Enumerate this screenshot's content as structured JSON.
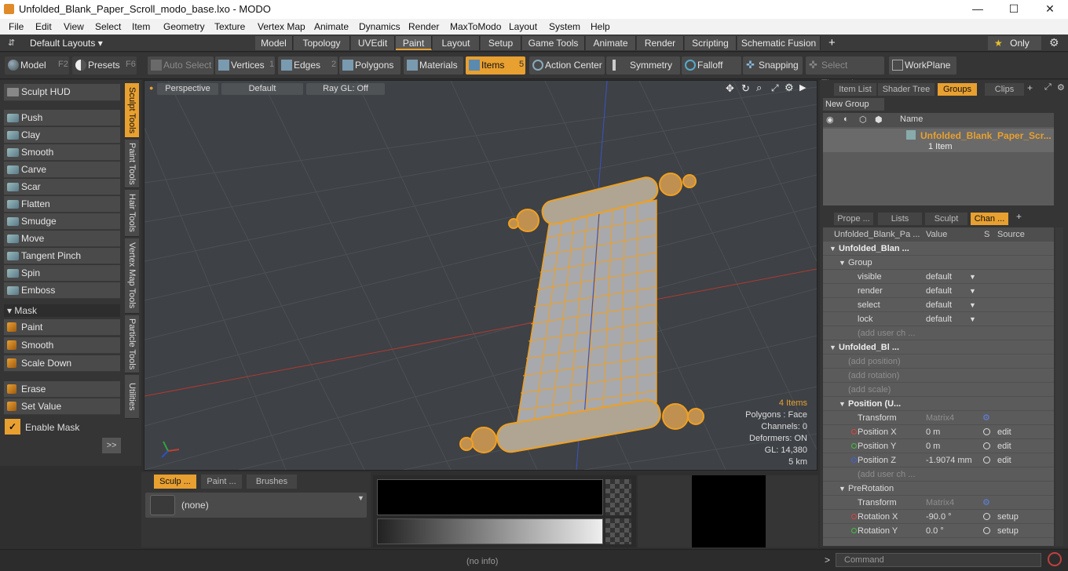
{
  "window": {
    "title": "Unfolded_Blank_Paper_Scroll_modo_base.lxo - MODO",
    "minimize": "—",
    "maximize": "☐",
    "close": "✕"
  },
  "menu": [
    "File",
    "Edit",
    "View",
    "Select",
    "Item",
    "Geometry",
    "Texture",
    "Vertex Map",
    "Animate",
    "Dynamics",
    "Render",
    "MaxToModo",
    "Layout",
    "System",
    "Help"
  ],
  "layoutbar": {
    "layouts": "Default Layouts ▾",
    "tabs": [
      "Model",
      "Topology",
      "UVEdit",
      "Paint",
      "Layout",
      "Setup",
      "Game Tools",
      "Animate",
      "Render",
      "Scripting",
      "Schematic Fusion"
    ],
    "active_tab": "Paint",
    "only": "Only",
    "plus": "+"
  },
  "toolbar": {
    "model": "Model",
    "model_key": "F2",
    "presets": "Presets",
    "presets_key": "F6",
    "auto_select": "Auto Select",
    "vertices": "Vertices",
    "vertices_key": "1",
    "edges": "Edges",
    "edges_key": "2",
    "polygons": "Polygons",
    "materials": "Materials",
    "items": "Items",
    "items_key": "5",
    "action_center": "Action Center",
    "symmetry": "Symmetry",
    "falloff": "Falloff",
    "snapping": "Snapping",
    "select_through": "Select Through",
    "workplane": "WorkPlane"
  },
  "left": {
    "sculpt_hud": "Sculpt HUD",
    "tools": [
      "Push",
      "Clay",
      "Smooth",
      "Carve",
      "Scar",
      "Flatten",
      "Smudge",
      "Move",
      "Tangent Pinch",
      "Spin",
      "Emboss"
    ],
    "mask_header": "Mask",
    "mask_tools": [
      "Paint",
      "Smooth",
      "Scale Down"
    ],
    "erase": "Erase",
    "set_value": "Set Value",
    "enable_mask": "Enable Mask",
    "more": ">>",
    "vtabs": [
      "Sculpt Tools",
      "Paint Tools",
      "Hair Tools",
      "Vertex Map Tools",
      "Particle Tools",
      "Utilities"
    ]
  },
  "viewport": {
    "view": "Perspective",
    "shading": "Default",
    "render": "Ray GL: Off",
    "stats": [
      "4 Items",
      "Polygons : Face",
      "Channels: 0",
      "Deformers: ON",
      "GL: 14,380",
      "5 km"
    ]
  },
  "groups_panel": {
    "tabs": [
      "Item List",
      "Shader Tree",
      "Groups",
      "Clips"
    ],
    "active_tab": "Groups",
    "new_group": "New Group",
    "col_name": "Name",
    "group_name": "Unfolded_Blank_Paper_Scr...",
    "group_count": "1 Item"
  },
  "channels_panel": {
    "tabs": [
      "Prope ...",
      "Lists",
      "Sculpt",
      "Chan ..."
    ],
    "active_tab": "Chan ...",
    "headers": [
      "Unfolded_Blank_Pa ...",
      "Value",
      "S",
      "Source"
    ],
    "rows": [
      {
        "indent": 1,
        "label": "Unfolded_Blan ...",
        "value": "",
        "source": "",
        "kind": "item"
      },
      {
        "indent": 2,
        "label": "Group",
        "value": "",
        "source": "",
        "kind": "group"
      },
      {
        "indent": 3,
        "label": "visible",
        "value": "default",
        "source": "",
        "kind": "drop"
      },
      {
        "indent": 3,
        "label": "render",
        "value": "default",
        "source": "",
        "kind": "drop"
      },
      {
        "indent": 3,
        "label": "select",
        "value": "default",
        "source": "",
        "kind": "drop"
      },
      {
        "indent": 3,
        "label": "lock",
        "value": "default",
        "source": "",
        "kind": "drop"
      },
      {
        "indent": 3,
        "label": "(add user ch ...",
        "value": "",
        "source": "",
        "kind": "dim"
      },
      {
        "indent": 1,
        "label": "Unfolded_Bl ...",
        "value": "",
        "source": "",
        "kind": "bold"
      },
      {
        "indent": 2,
        "label": "(add position)",
        "value": "",
        "source": "",
        "kind": "dim"
      },
      {
        "indent": 2,
        "label": "(add rotation)",
        "value": "",
        "source": "",
        "kind": "dim"
      },
      {
        "indent": 2,
        "label": "(add scale)",
        "value": "",
        "source": "",
        "kind": "dim"
      },
      {
        "indent": 2,
        "label": "Position (U...",
        "value": "",
        "source": "",
        "kind": "bold"
      },
      {
        "indent": 3,
        "label": "Transform",
        "value": "Matrix4",
        "source": "",
        "kind": "matrix"
      },
      {
        "indent": 3,
        "label": "Position X",
        "value": "0 m",
        "source": "edit",
        "kind": "xyz-x"
      },
      {
        "indent": 3,
        "label": "Position Y",
        "value": "0 m",
        "source": "edit",
        "kind": "xyz-y"
      },
      {
        "indent": 3,
        "label": "Position Z",
        "value": "-1.9074 mm",
        "source": "edit",
        "kind": "xyz-z"
      },
      {
        "indent": 3,
        "label": "(add user ch ...",
        "value": "",
        "source": "",
        "kind": "dim"
      },
      {
        "indent": 2,
        "label": "PreRotation",
        "value": "",
        "source": "",
        "kind": "group"
      },
      {
        "indent": 3,
        "label": "Transform",
        "value": "Matrix4",
        "source": "",
        "kind": "matrix"
      },
      {
        "indent": 3,
        "label": "Rotation X",
        "value": "-90.0 °",
        "source": "setup",
        "kind": "xyz-x"
      },
      {
        "indent": 3,
        "label": "Rotation Y",
        "value": "0.0 °",
        "source": "setup",
        "kind": "xyz-y"
      }
    ]
  },
  "bottom": {
    "tabs": [
      "Sculp ...",
      "Paint ...",
      "Brushes"
    ],
    "brush": "(none)"
  },
  "status": {
    "info": "(no info)",
    "command_placeholder": "Command"
  },
  "colors": {
    "accent": "#e8a030",
    "mesh": "#f0a020"
  }
}
